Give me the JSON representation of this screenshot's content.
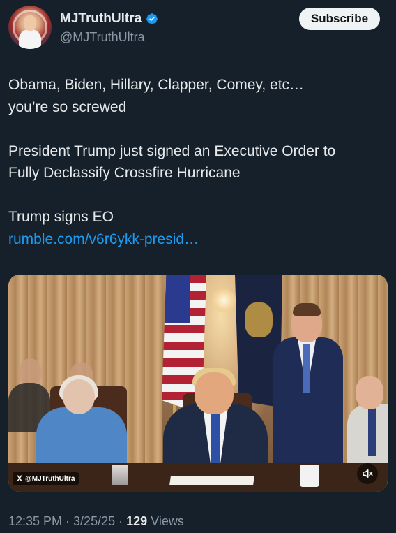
{
  "author": {
    "display_name": "MJTruthUltra",
    "handle": "@MJTruthUltra",
    "verified": true,
    "avatar_icon": "profile-avatar"
  },
  "subscribe_label": "Subscribe",
  "post": {
    "line1": "Obama, Biden, Hillary, Clapper, Comey, etc…",
    "line2": "you’re so screwed",
    "line3": "President Trump just signed an Executive Order to",
    "line4": "Fully Declassify Crossfire Hurricane",
    "line5": "Trump signs EO",
    "link_text": "rumble.com/v6r6ykk-presid…"
  },
  "media": {
    "watermark_text": "@MJTruthUltra",
    "watermark_logo": "X",
    "mute_icon": "volume-muted-icon"
  },
  "footer": {
    "time": "12:35 PM",
    "date": "3/25/25",
    "views_count": "129",
    "views_label": "Views",
    "separator": "·"
  },
  "colors": {
    "background": "#15202b",
    "link": "#1d9bf0",
    "verified": "#1d9bf0",
    "muted_text": "#8b98a5"
  }
}
